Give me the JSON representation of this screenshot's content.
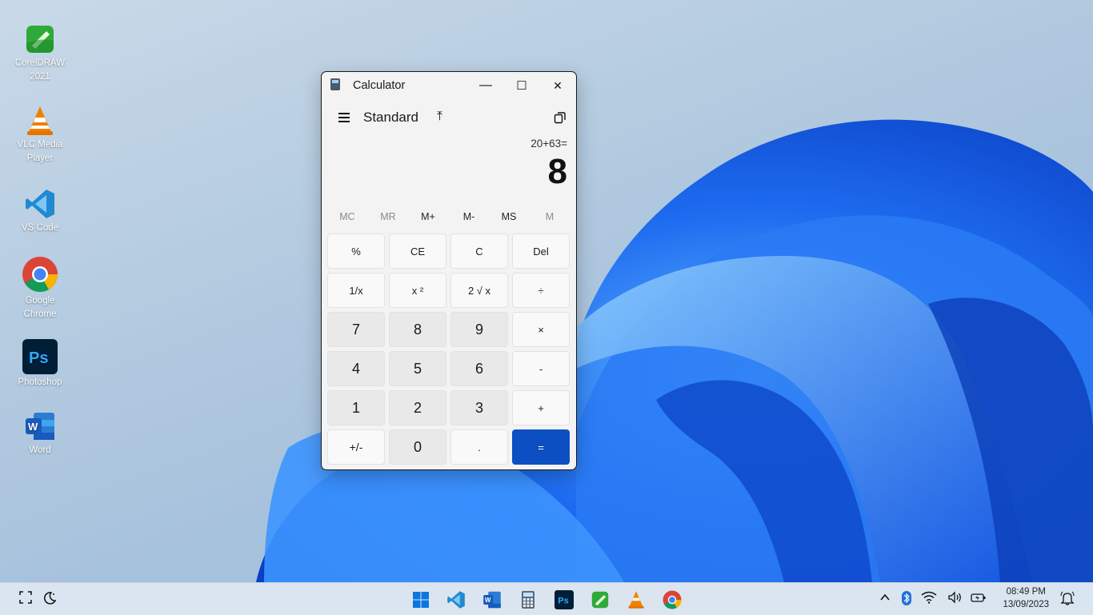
{
  "desktop": {
    "icons": [
      {
        "label_line1": "CorelDRAW",
        "label_line2": "2021"
      },
      {
        "label_line1": "VLC Media",
        "label_line2": "Player"
      },
      {
        "label_line1": "VS Code",
        "label_line2": ""
      },
      {
        "label_line1": "Google",
        "label_line2": "Chrome"
      },
      {
        "label_line1": "Photoshop",
        "label_line2": ""
      },
      {
        "label_line1": "Word",
        "label_line2": ""
      }
    ]
  },
  "calculator": {
    "title": "Calculator",
    "minimize": "—",
    "maximize": "☐",
    "close": "✕",
    "mode": "Standard",
    "pin_glyph": "⤒",
    "expression": "20+63=",
    "result": "8",
    "memory": [
      "MC",
      "MR",
      "M+",
      "M-",
      "MS",
      "M"
    ],
    "keys": {
      "percent": "%",
      "ce": "CE",
      "clear": "C",
      "del": "Del",
      "reciprocal": "1/x",
      "square": "x ²",
      "sqrt": "2 √ x",
      "divide": "÷",
      "seven": "7",
      "eight": "8",
      "nine": "9",
      "multiply": "×",
      "four": "4",
      "five": "5",
      "six": "6",
      "minus": "-",
      "one": "1",
      "two": "2",
      "three": "3",
      "plus": "+",
      "negate": "+/-",
      "zero": "0",
      "decimal": ".",
      "equals": "="
    },
    "colors": {
      "equals_bg": "#0b4fc2"
    }
  },
  "taskbar": {
    "time": "08:49 PM",
    "date": "13/09/2023",
    "icons": [
      "start-icon",
      "vscode-icon",
      "word-icon",
      "calculator-icon",
      "photoshop-icon",
      "coreldraw-icon",
      "vlc-icon",
      "chrome-icon"
    ]
  }
}
